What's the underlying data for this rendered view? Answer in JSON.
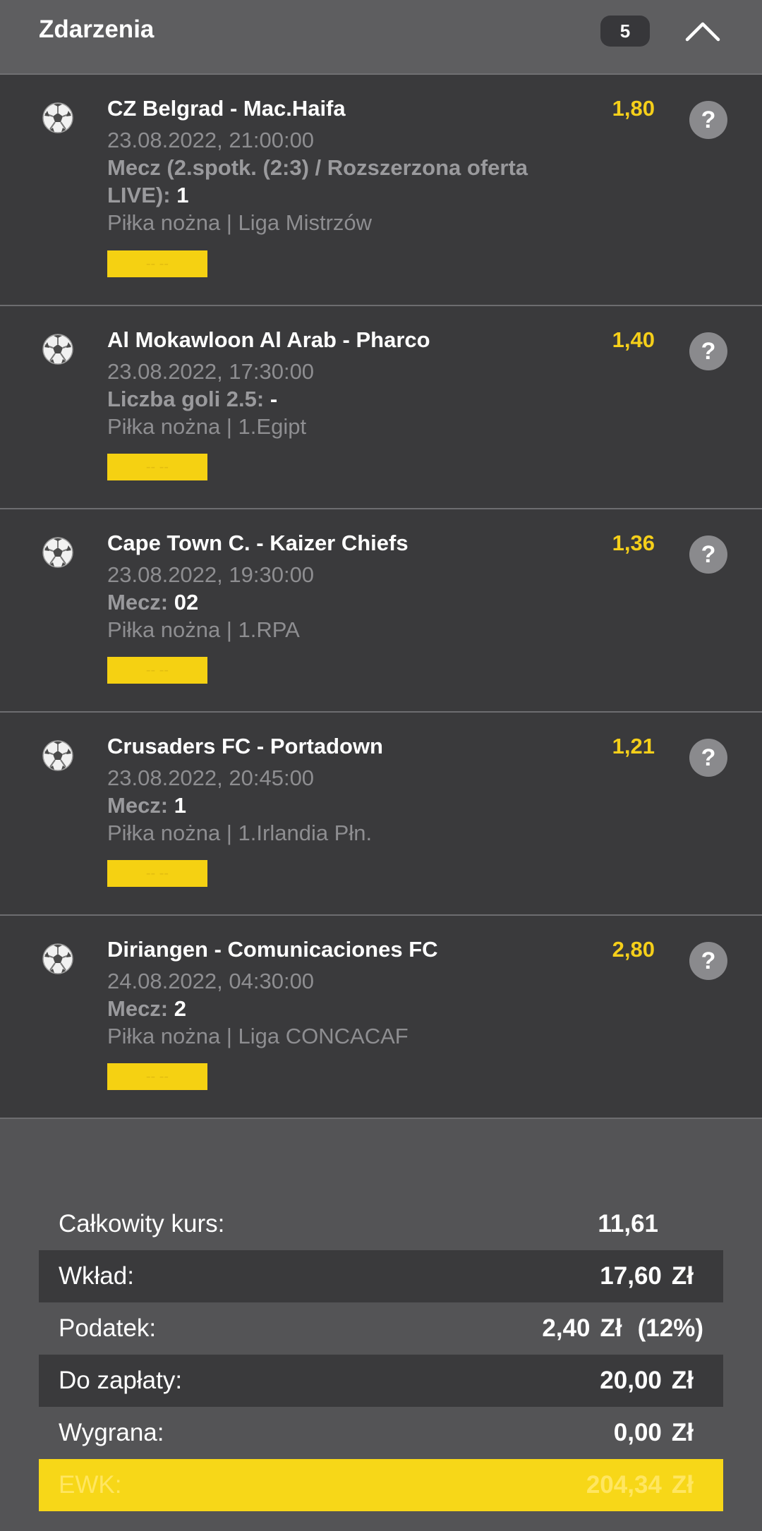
{
  "header": {
    "title": "Zdarzenia",
    "count": "5"
  },
  "events": [
    {
      "title": "CZ Belgrad - Mac.Haifa",
      "odds": "1,80",
      "date": "23.08.2022, 21:00:00",
      "bet_line1": "Mecz (2.spotk. (2:3) / Rozszerzona oferta",
      "bet_line2": "LIVE):",
      "pick": "1",
      "league": "Piłka nożna | Liga Mistrzów",
      "status": "-- --",
      "help": "?"
    },
    {
      "title": "Al Mokawloon Al Arab - Pharco",
      "odds": "1,40",
      "date": "23.08.2022, 17:30:00",
      "bet": "Liczba goli 2.5:",
      "pick": "-",
      "league": "Piłka nożna | 1.Egipt",
      "status": "-- --",
      "help": "?"
    },
    {
      "title": "Cape Town C. - Kaizer Chiefs",
      "odds": "1,36",
      "date": "23.08.2022, 19:30:00",
      "bet": "Mecz:",
      "pick": "02",
      "league": "Piłka nożna | 1.RPA",
      "status": "-- --",
      "help": "?"
    },
    {
      "title": "Crusaders FC - Portadown",
      "odds": "1,21",
      "date": "23.08.2022, 20:45:00",
      "bet": "Mecz:",
      "pick": "1",
      "league": "Piłka nożna | 1.Irlandia Płn.",
      "status": "-- --",
      "help": "?"
    },
    {
      "title": "Diriangen - Comunicaciones FC",
      "odds": "2,80",
      "date": "24.08.2022, 04:30:00",
      "bet": "Mecz:",
      "pick": "2",
      "league": "Piłka nożna | Liga CONCACAF",
      "status": "-- --",
      "help": "?"
    }
  ],
  "summary": {
    "total_odds_label": "Całkowity kurs:",
    "total_odds_value": "11,61",
    "stake_label": "Wkład:",
    "stake_value": "17,60",
    "tax_label": "Podatek:",
    "tax_value": "2,40",
    "tax_percent": "(12%)",
    "to_pay_label": "Do zapłaty:",
    "to_pay_value": "20,00",
    "win_label": "Wygrana:",
    "win_value": "0,00",
    "ewk_label": "EWK:",
    "ewk_value": "204,34",
    "currency": "Zł"
  },
  "colors": {
    "accent_yellow": "#f5d112",
    "odds_yellow": "#f5cf1a",
    "panel_dark": "#3a3a3c",
    "background_gray": "#545456"
  }
}
